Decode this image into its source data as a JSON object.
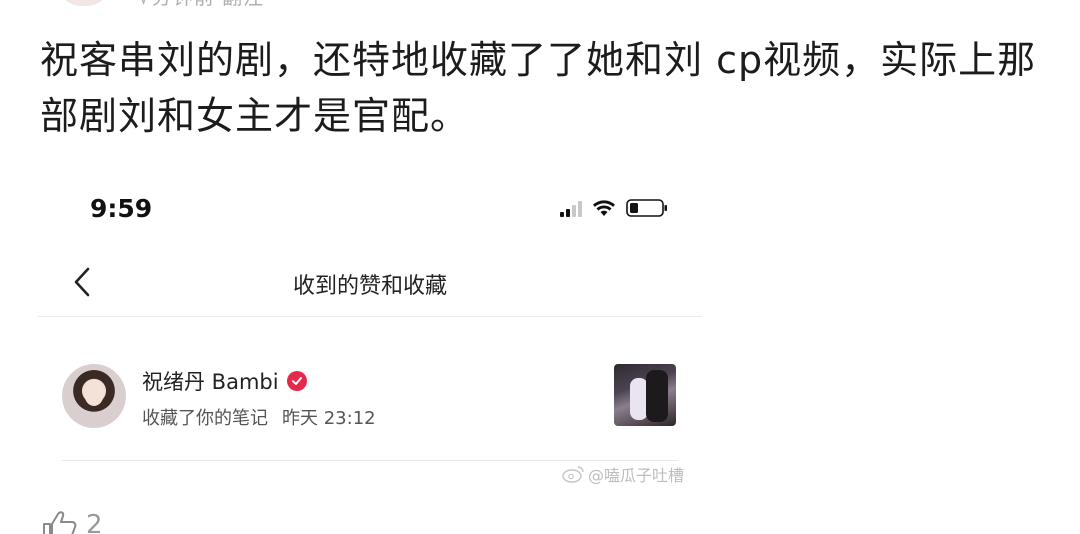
{
  "post": {
    "top_cut_text": "√分钟前  翻注",
    "body_text": "祝客串刘的剧，还特地收藏了了她和刘 cp视频，实际上那部剧刘和女主才是官配。"
  },
  "screenshot": {
    "status_bar": {
      "time": "9:59",
      "signal_icon": "signal-icon",
      "wifi_icon": "wifi-icon",
      "battery_icon": "battery-icon"
    },
    "nav": {
      "back_icon": "chevron-left-icon",
      "title": "收到的赞和收藏"
    },
    "notification": {
      "user_name": "祝绪丹 Bambi",
      "verified_icon": "verified-badge-icon",
      "action": "收藏了你的笔记",
      "time": "昨天 23:12"
    },
    "watermark": "@嗑瓜子吐槽"
  },
  "like": {
    "icon": "thumbs-up-icon",
    "count": "2"
  },
  "colors": {
    "verified_red": "#e6284b",
    "text": "#1c1c1c",
    "muted": "#555555"
  }
}
